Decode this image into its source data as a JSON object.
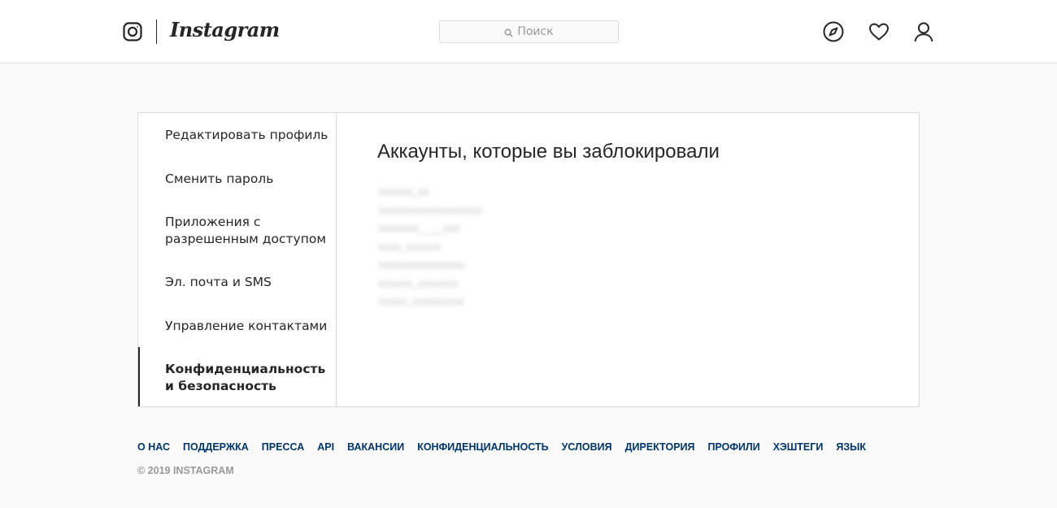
{
  "header": {
    "wordmark": "Instagram",
    "search_placeholder": "Поиск",
    "icons": [
      "instagram-glyph-icon",
      "compass-icon",
      "heart-icon",
      "profile-icon"
    ]
  },
  "sidebar": {
    "items": [
      {
        "label": "Редактировать профиль",
        "active": false
      },
      {
        "label": "Сменить пароль",
        "active": false
      },
      {
        "label": "Приложения с разрешенным доступом",
        "active": false
      },
      {
        "label": "Эл. почта и SMS",
        "active": false
      },
      {
        "label": "Управление контактами",
        "active": false
      },
      {
        "label": "Конфиденциальность и безопасность",
        "active": true
      }
    ]
  },
  "main": {
    "title": "Аккаунты, которые вы заблокировали",
    "blocked_accounts": [
      "xxxxxx_xx",
      "xxxxxxxxxxxxxxxxxx",
      "xxxxxxx_____xxx",
      "xxxx_xxxxxx",
      "xxxxxxxxxxxxxxx",
      "xxxxxx_xxxxxxx",
      "xxxxx_xxxxxxxxx"
    ]
  },
  "footer": {
    "links": [
      "О НАС",
      "ПОДДЕРЖКА",
      "ПРЕССА",
      "API",
      "ВАКАНСИИ",
      "КОНФИДЕНЦИАЛЬНОСТЬ",
      "УСЛОВИЯ",
      "ДИРЕКТОРИЯ",
      "ПРОФИЛИ",
      "ХЭШТЕГИ",
      "ЯЗЫК"
    ],
    "copyright": "© 2019 INSTAGRAM"
  },
  "colors": {
    "background": "#fafafa",
    "border": "#dbdbdb",
    "text": "#262626",
    "footer_link": "#003569",
    "muted": "#999999"
  }
}
